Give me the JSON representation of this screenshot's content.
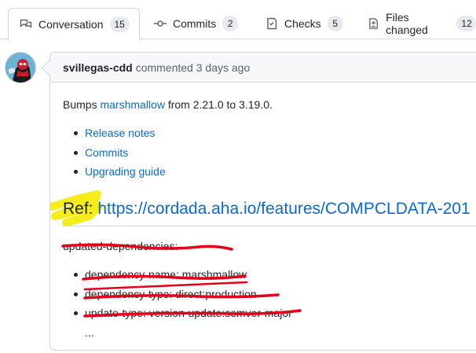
{
  "tabs": [
    {
      "label": "Conversation",
      "count": "15",
      "icon": "conversation-icon",
      "active": true
    },
    {
      "label": "Commits",
      "count": "2",
      "icon": "commit-icon",
      "active": false
    },
    {
      "label": "Checks",
      "count": "5",
      "icon": "checklist-icon",
      "active": false
    },
    {
      "label": "Files changed",
      "count": "12",
      "icon": "file-diff-icon",
      "active": false
    }
  ],
  "comment": {
    "author": "svillegas-cdd",
    "action": "commented 3 days ago",
    "bumps": {
      "prefix": "Bumps",
      "package": "marshmallow",
      "suffix": "from 2.21.0 to 3.19.0."
    },
    "links": [
      "Release notes",
      "Commits",
      "Upgrading guide"
    ],
    "ref": {
      "label": "Ref:",
      "url": "https://cordada.aha.io/features/COMPCLDATA-201"
    },
    "updated_dependencies": "updated-dependencies:",
    "dependency_items": [
      "dependency-name: marshmallow",
      "dependency-type: direct:production",
      "update-type: version-update:semver-major"
    ],
    "ellipsis": "..."
  },
  "colors": {
    "link": "#0969da",
    "highlight": "#f5ea00",
    "redaction": "#e3001b",
    "border": "#d0d7de"
  }
}
